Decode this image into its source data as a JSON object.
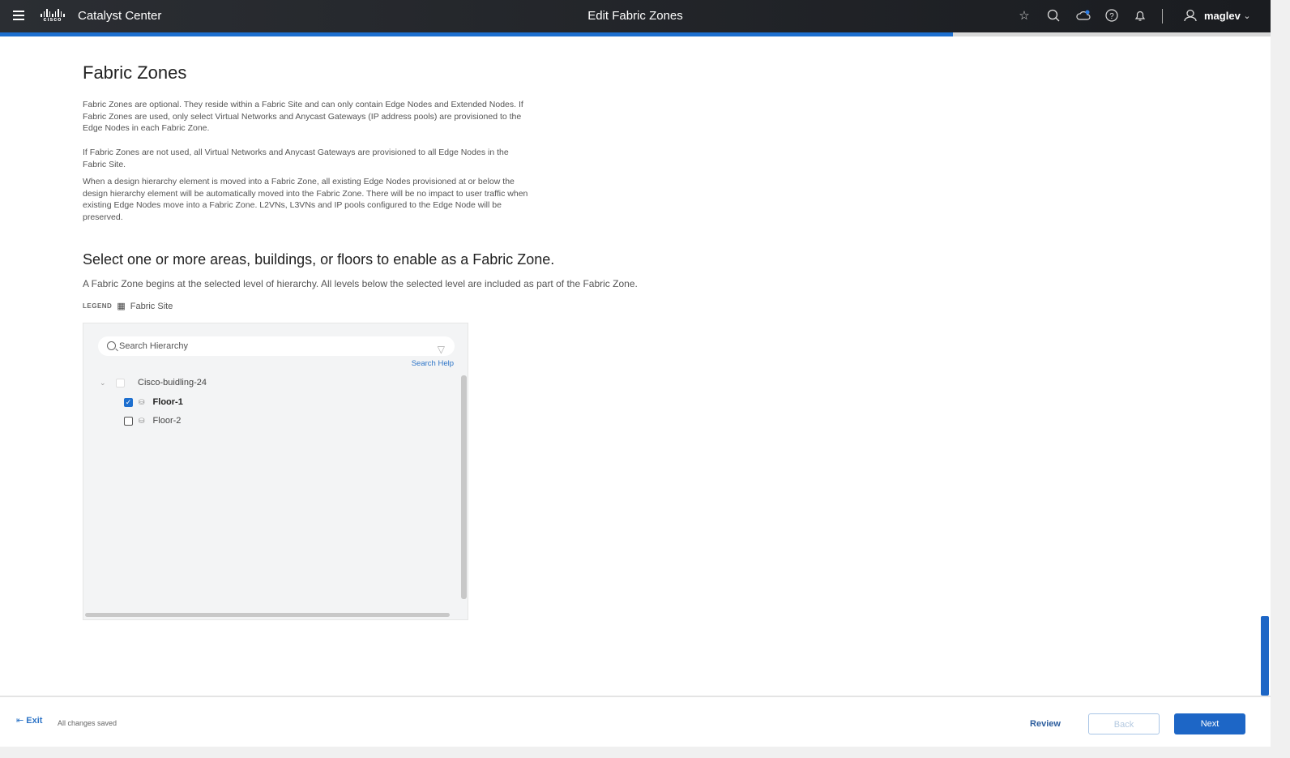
{
  "header": {
    "app_name": "Catalyst Center",
    "logo_text": "cisco",
    "page_title": "Edit Fabric Zones",
    "username": "maglev",
    "icons": [
      "menu-icon",
      "star-icon",
      "search-icon",
      "cloud-icon",
      "help-icon",
      "bell-icon",
      "user-icon",
      "chevron-down-icon"
    ]
  },
  "progress_percent": 75,
  "main": {
    "title": "Fabric Zones",
    "paragraphs": [
      "Fabric Zones are optional. They reside within a Fabric Site and can only contain Edge Nodes and Extended Nodes. If Fabric Zones are used, only select Virtual Networks and Anycast Gateways (IP address pools) are provisioned to the Edge Nodes in each Fabric Zone.",
      "If Fabric Zones are not used, all Virtual Networks and Anycast Gateways are provisioned to all Edge Nodes in the Fabric Site.",
      "When a design hierarchy element is moved into a Fabric Zone, all existing Edge Nodes provisioned at or below the design hierarchy element will be automatically moved into the Fabric Zone. There will be no impact to user traffic when existing Edge Nodes move into a Fabric Zone. L2VNs, L3VNs and IP pools configured to the Edge Node will be preserved."
    ],
    "select_heading": "Select one or more areas, buildings, or floors to enable as a Fabric Zone.",
    "select_sub": "A Fabric Zone begins at the selected level of hierarchy. All levels below the selected level are included as part of the Fabric Zone.",
    "legend_label": "LEGEND",
    "legend_item": "Fabric Site"
  },
  "tree": {
    "search_placeholder": "Search Hierarchy",
    "search_help": "Search Help",
    "nodes": [
      {
        "label": "Cisco-buidling-24",
        "checked": false,
        "disabled": true
      },
      {
        "label": "Floor-1",
        "checked": true
      },
      {
        "label": "Floor-2",
        "checked": false
      }
    ]
  },
  "footer": {
    "exit": "Exit",
    "status": "All changes saved",
    "review": "Review",
    "back": "Back",
    "next": "Next"
  },
  "colors": {
    "accent": "#1d66c6",
    "header_bg": "#1f2125"
  }
}
